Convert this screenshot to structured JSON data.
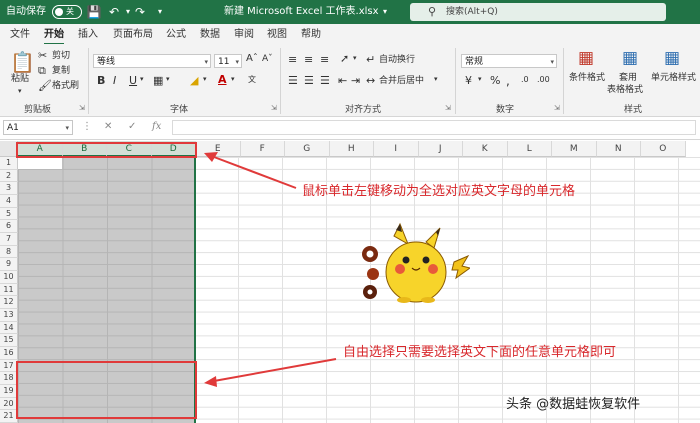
{
  "titlebar": {
    "autosave_label": "自动保存",
    "autosave_state": "关",
    "filename": "新建 Microsoft Excel 工作表.xlsx",
    "search_placeholder": "搜索(Alt+Q)"
  },
  "menu": {
    "tabs": [
      "文件",
      "开始",
      "插入",
      "页面布局",
      "公式",
      "数据",
      "审阅",
      "视图",
      "帮助"
    ],
    "active": "开始"
  },
  "ribbon": {
    "clipboard": {
      "paste": "粘贴",
      "cut": "剪切",
      "copy": "复制",
      "format_painter": "格式刷",
      "label": "剪贴板"
    },
    "font": {
      "name": "等线",
      "size": "11",
      "label": "字体"
    },
    "alignment": {
      "wrap": "自动换行",
      "merge": "合并后居中",
      "label": "对齐方式"
    },
    "number": {
      "format": "常规",
      "label": "数字"
    },
    "styles": {
      "conditional": "条件格式",
      "table_line1": "套用",
      "table_line2": "表格格式",
      "cell_styles": "单元格样式",
      "label": "样式"
    }
  },
  "formula_bar": {
    "name_box": "A1",
    "fx": "fx"
  },
  "sheet": {
    "columns": [
      "A",
      "B",
      "C",
      "D",
      "E",
      "F",
      "G",
      "H",
      "I",
      "J",
      "K",
      "L",
      "M",
      "N",
      "O"
    ],
    "rows": [
      "1",
      "2",
      "3",
      "4",
      "5",
      "6",
      "7",
      "8",
      "9",
      "10",
      "11",
      "12",
      "13",
      "14",
      "15",
      "16",
      "17",
      "18",
      "19",
      "20",
      "21"
    ]
  },
  "annotations": {
    "top": "鼠标单击左键移动为全选对应英文字母的单元格",
    "bottom": "自由选择只需要选择英文下面的任意单元格即可"
  },
  "watermark": "头条 @数据蛙恢复软件",
  "colors": {
    "excel_green": "#217346",
    "annotation_red": "#e03a3a",
    "selection_gray": "#c9c9c9"
  }
}
